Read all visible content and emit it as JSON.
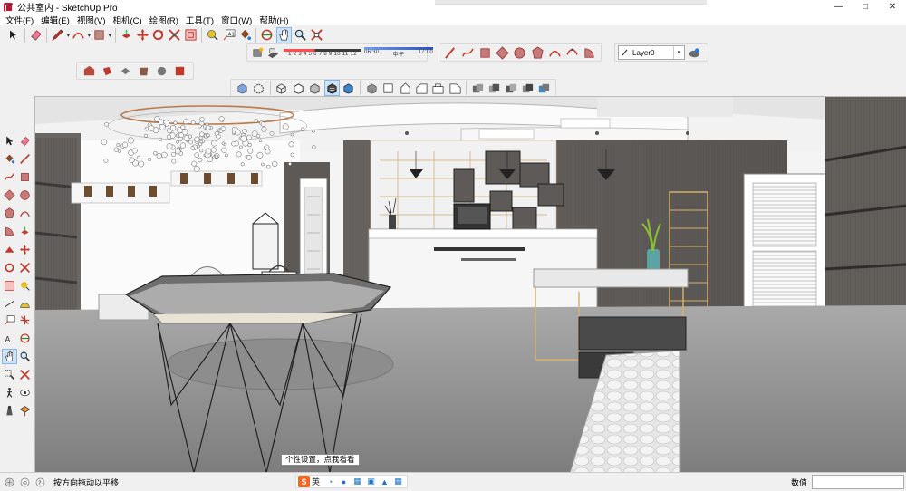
{
  "window": {
    "title": "公共室内 - SketchUp Pro",
    "controls": {
      "minimize": "—",
      "maximize": "□",
      "close": "✕"
    }
  },
  "menu": [
    "文件(F)",
    "编辑(E)",
    "视图(V)",
    "相机(C)",
    "绘图(R)",
    "工具(T)",
    "窗口(W)",
    "帮助(H)"
  ],
  "shadows": {
    "month_scale": "1 2 3 4 5 6 7 8 9 10 11 12",
    "time_start": "06:30",
    "time_mid": "中午",
    "time_end": "17:00"
  },
  "layers": {
    "current": "Layer0"
  },
  "tooltip": "个性设置，点我看看",
  "status": {
    "message": "按方向拖动以平移",
    "measurements_label": "数值",
    "measurements_value": ""
  },
  "ime": {
    "logo": "S",
    "language": "英"
  },
  "icons": {
    "top_toolbar": [
      "select-icon",
      "eraser-icon",
      "pencil-icon",
      "arc-icon",
      "rectangle-icon",
      "push-pull-icon",
      "move-icon",
      "rotate-icon",
      "scale-icon",
      "offset-icon",
      "tape-measure-icon",
      "text-icon",
      "paint-bucket-icon",
      "orbit-icon",
      "pan-icon",
      "zoom-icon",
      "zoom-extents-icon"
    ],
    "left_toolbar": [
      "select-icon",
      "eraser-icon",
      "paint-bucket-icon",
      "line-icon",
      "freehand-icon",
      "rectangle-icon",
      "rotated-rectangle-icon",
      "circle-icon",
      "polygon-icon",
      "arc-icon",
      "pie-icon",
      "push-pull-icon",
      "follow-me-icon",
      "move-icon",
      "rotate-icon",
      "scale-icon",
      "offset-icon",
      "tape-measure-icon",
      "dimension-icon",
      "protractor-icon",
      "text-icon",
      "axes-icon",
      "3d-text-icon",
      "orbit-icon",
      "pan-icon",
      "zoom-icon",
      "zoom-window-icon",
      "zoom-extents-icon",
      "walk-icon",
      "look-around-icon",
      "position-camera-icon",
      "section-plane-icon"
    ]
  },
  "colors": {
    "accent_selected": "#cfe3f7",
    "toolbar_bg": "#f0f0f0",
    "viewport_floor": "#8f8f8f",
    "wall_dark": "#5a5653",
    "counter_white": "#f6f6f6",
    "shelf_wood": "#d7b16b"
  }
}
